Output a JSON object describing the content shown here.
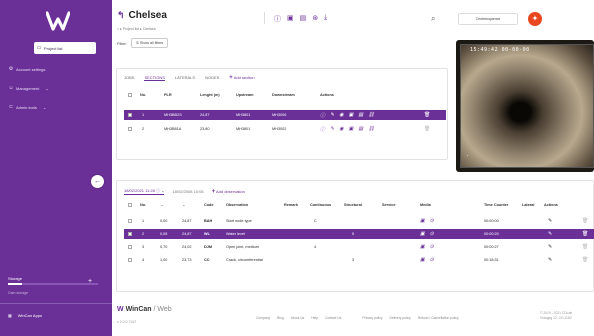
{
  "sidebar": {
    "logo": "W",
    "items": [
      {
        "icon": "folder-icon",
        "label": "Project list"
      },
      {
        "icon": "gear-icon",
        "label": "Account settings"
      },
      {
        "icon": "users-icon",
        "label": "Management"
      },
      {
        "icon": "admin-icon",
        "label": "Admin tools"
      }
    ],
    "storage_label": "Storage",
    "storage_fraction": 0.15,
    "storage_sub": "Gain storage",
    "apps_label": "WinCan Apps"
  },
  "header": {
    "title": "Chelsea",
    "breadcrumb": [
      "Project list",
      "Chelsea"
    ],
    "filter_label": "Filter:",
    "filter_button": "Show all filters",
    "user_label": "Centreloquence"
  },
  "sections_card": {
    "tabs": [
      "JOBS",
      "SECTIONS",
      "LATERALS",
      "NODES"
    ],
    "active_tab": "SECTIONS",
    "add_label": "Add section",
    "columns": [
      "No.",
      "PLR",
      "Lenght (m)",
      "Upstream",
      "Downstream",
      "Actions"
    ],
    "rows": [
      {
        "no": "1",
        "plr": "MH3BB2S",
        "length": "24,87",
        "up": "MH3801",
        "down": "MH3006",
        "selected": true
      },
      {
        "no": "2",
        "plr": "MH3B81A",
        "length": "23,80",
        "up": "MH3801",
        "down": "MH3002",
        "selected": false
      }
    ]
  },
  "observations_card": {
    "inspection": "18/02/2021 11:28",
    "inspection2": "18/02/2008 10:06",
    "add_label": "Add observation",
    "columns": [
      "No.",
      "→",
      "←",
      "Code",
      "Observation",
      "Remark",
      "Continuous",
      "Structural",
      "Service",
      "Media",
      "Time Counter",
      "Lateral",
      "Actions"
    ],
    "rows": [
      {
        "no": "1",
        "a": "0,00",
        "b": "24,87",
        "code": "BAH",
        "obs": "Start node type",
        "remark": "",
        "cont": "C",
        "struct": "",
        "serv": "",
        "time": "00:00:00",
        "selected": false
      },
      {
        "no": "2",
        "a": "0,05",
        "b": "24,87",
        "code": "WL",
        "obs": "Water level",
        "remark": "",
        "cont": "",
        "struct": "5",
        "serv": "",
        "time": "00:00:20",
        "selected": true
      },
      {
        "no": "3",
        "a": "0,70",
        "b": "24,02",
        "code": "DJM",
        "obs": "Open joint, medium",
        "remark": "",
        "cont": "4",
        "struct": "",
        "serv": "",
        "time": "00:00:27",
        "selected": false
      },
      {
        "no": "4",
        "a": "1,00",
        "b": "23,73",
        "code": "CC",
        "obs": "Crack, circumferential",
        "remark": "",
        "cont": "",
        "struct": "3",
        "serv": "",
        "time": "00:18:31",
        "selected": false
      }
    ]
  },
  "video": {
    "osd": "15:49:42 00-00-00"
  },
  "footer": {
    "brand": "WinCan",
    "brand_sub": "/ Web",
    "version": "v 2.0.0.7167",
    "links": [
      "Company",
      "Blog",
      "About Us",
      "Help",
      "Contact Us",
      "Privacy policy",
      "Delivery policy",
      "Refund / Cancellation policy"
    ],
    "copyright": "© 2019 - 2021 CDLab",
    "copyright2": "Vraagsg 12, CH-1180"
  }
}
